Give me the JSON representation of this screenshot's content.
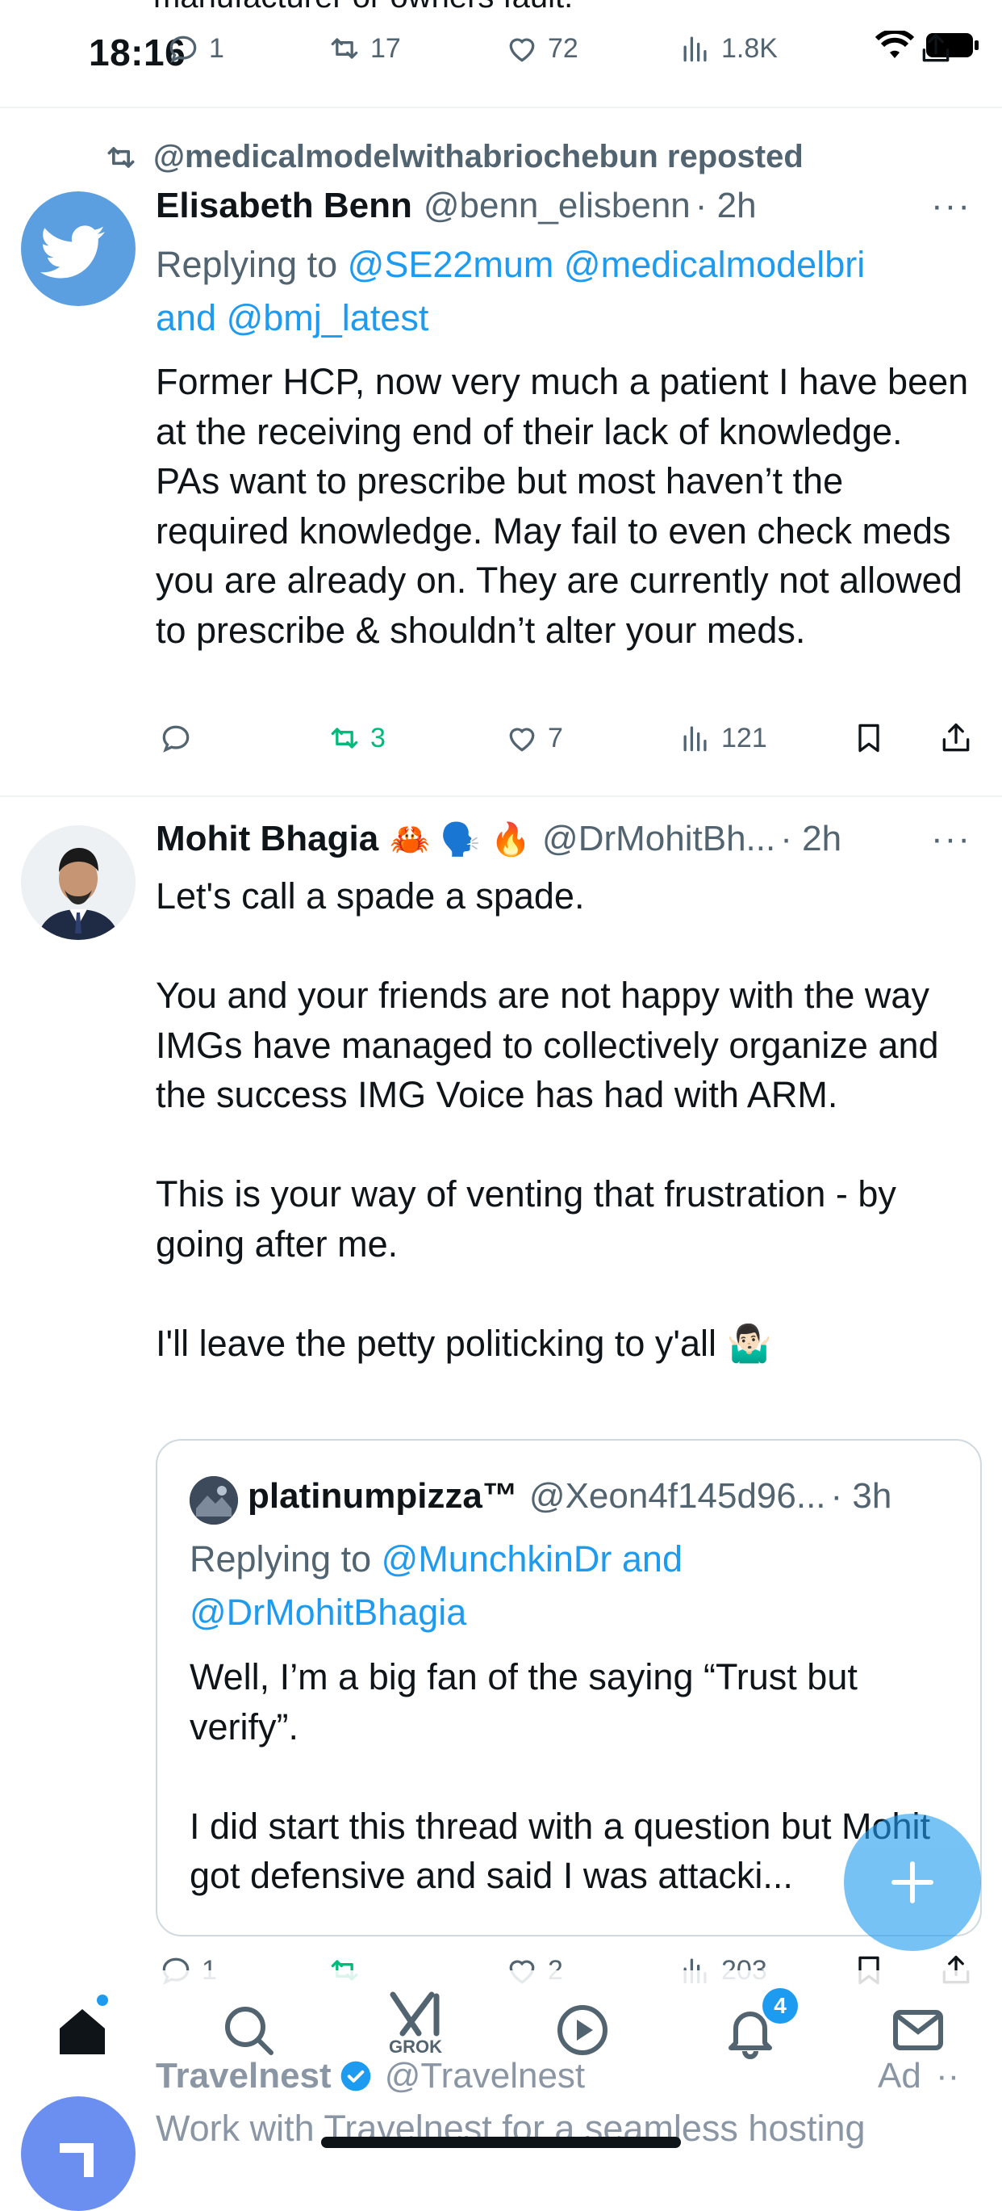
{
  "status_bar": {
    "time": "18:16"
  },
  "top_partial": {
    "clipped_text": "manufacturer or owners fault.",
    "replies": "1",
    "reposts": "17",
    "likes": "72",
    "views": "1.8K"
  },
  "post1": {
    "repost_context": "@medicalmodelwithabriochebun reposted",
    "name": "Elisabeth Benn",
    "handle": "@benn_elisbenn",
    "time": "· 2h",
    "replying_prefix": "Replying to ",
    "replying_mentions": "@SE22mum @medicalmodelbri",
    "replying_and": "and ",
    "replying_last": "@bmj_latest",
    "text": "Former HCP, now very much a patient I have been at the receiving end of their lack of knowledge. PAs want to prescribe but most haven’t the required knowledge. May fail to even check meds you are already on. They are currently not allowed to prescribe & shouldn’t alter your meds.",
    "reposts": "3",
    "likes": "7",
    "views": "121"
  },
  "post2": {
    "name": "Mohit Bhagia",
    "emojis": "🦀 🗣️ 🔥",
    "handle": "@DrMohitBh...",
    "time": "· 2h",
    "text": "Let's call a spade a spade.\n\nYou and your friends are not happy with the way IMGs have managed to collectively organize and the success IMG Voice has had with ARM.\n\nThis is your way of venting that frustration - by going after me.\n\nI'll leave the petty politicking to y'all 🤷🏻‍♂️",
    "replies": "1",
    "likes": "2",
    "views": "203",
    "quote": {
      "name": "platinumpizza™",
      "handle": "@Xeon4f145d96...",
      "time": "· 3h",
      "replying_prefix": "Replying to ",
      "replying_mention1": "@MunchkinDr and",
      "replying_mention2": "@DrMohitBhagia",
      "text": "Well, I’m a big fan of the saying “Trust but verify”.\n\nI did start this thread with a question but Mohit got defensive and said I was attacki..."
    }
  },
  "ad": {
    "name": "Travelnest",
    "handle": "@Travelnest",
    "label": "Ad",
    "text": "Work with Travelnest for a seamless hosting"
  },
  "bottom_nav": {
    "grok_label": "GROK",
    "notifications_badge": "4"
  },
  "colors": {
    "accent": "#1d9bf0",
    "repost_green": "#00ba7c",
    "muted": "#536471"
  }
}
